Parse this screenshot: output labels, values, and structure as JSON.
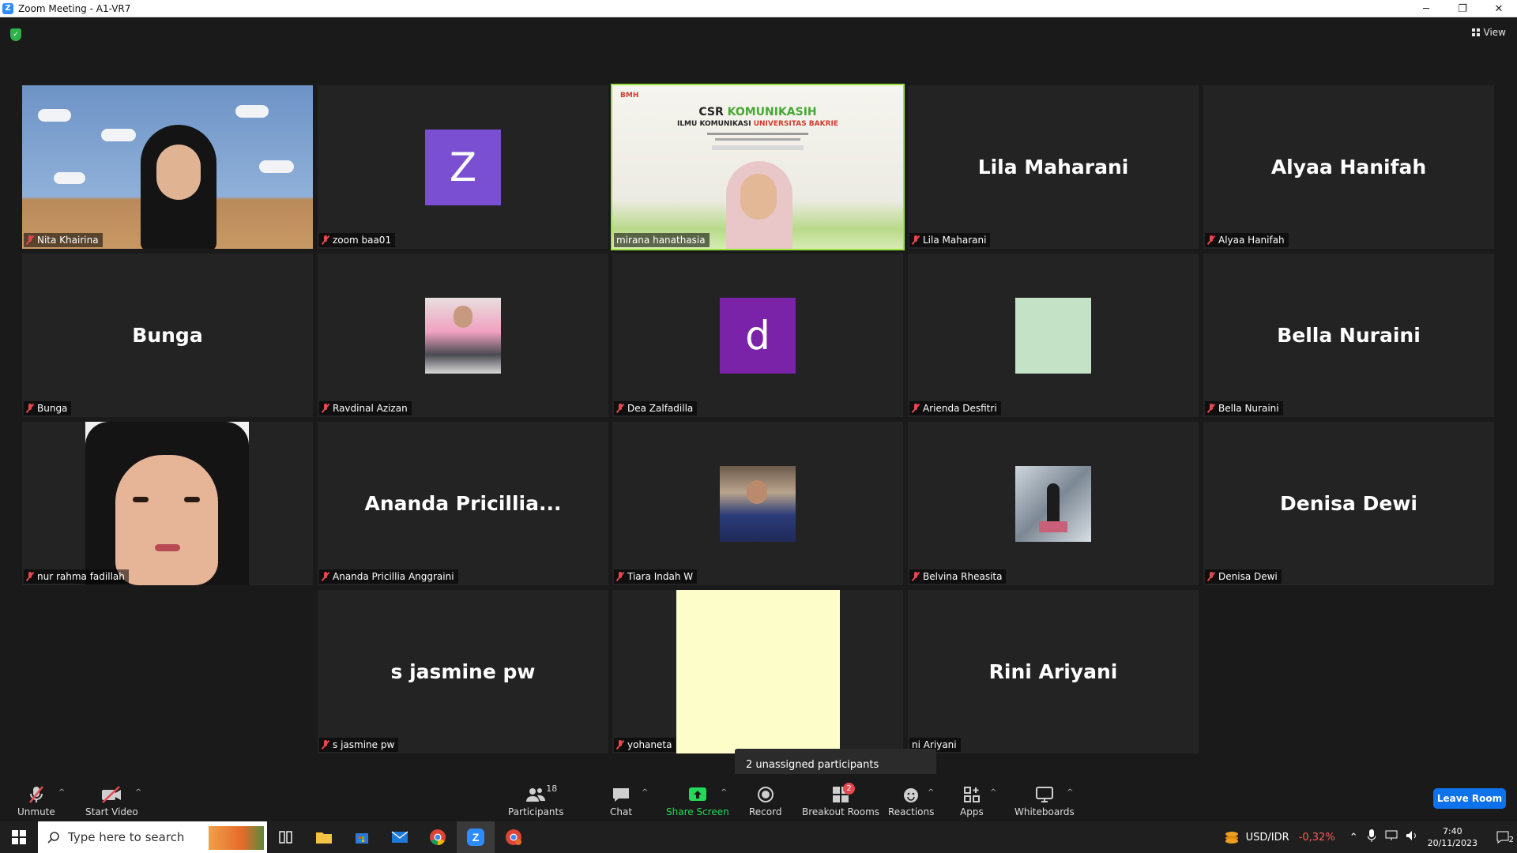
{
  "window": {
    "title": "Zoom Meeting - A1-VR7",
    "app_icon": "zoom-icon",
    "minimize": "─",
    "restore": "❐",
    "close": "✕"
  },
  "header": {
    "view_label": "View",
    "security_icon": "shield-icon"
  },
  "participants": [
    {
      "name": "Nita Khairina",
      "display": "",
      "muted": true
    },
    {
      "name": "zoom baa01",
      "display": "Z",
      "muted": true,
      "avatar_color": "#7b4fd1"
    },
    {
      "name": "mirana hanathasia",
      "display": "",
      "muted": false,
      "active_speaker": true
    },
    {
      "name": "Lila Maharani",
      "display": "Lila Maharani",
      "muted": true
    },
    {
      "name": "Alyaa Hanifah",
      "display": "Alyaa Hanifah",
      "muted": true
    },
    {
      "name": "Bunga",
      "display": "Bunga",
      "muted": true
    },
    {
      "name": "Ravdinal Azizan",
      "display": "",
      "muted": true
    },
    {
      "name": "Dea Zalfadilla",
      "display": "d",
      "muted": true,
      "avatar_color": "#7a22a8"
    },
    {
      "name": "Arienda Desfitri",
      "display": "",
      "muted": true,
      "avatar_color": "#c4e3c6"
    },
    {
      "name": "Bella Nuraini",
      "display": "Bella Nuraini",
      "muted": true
    },
    {
      "name": "nur rahma fadillah",
      "display": "",
      "muted": true
    },
    {
      "name": "Ananda Pricillia Anggraini",
      "display": "Ananda  Pricillia...",
      "muted": true
    },
    {
      "name": "Tiara Indah W",
      "display": "",
      "muted": true
    },
    {
      "name": "Belvina Rheasita",
      "display": "",
      "muted": true
    },
    {
      "name": "Denisa Dewi",
      "display": "Denisa Dewi",
      "muted": true
    },
    {
      "name": "s jasmine pw",
      "display": "s jasmine pw",
      "muted": true
    },
    {
      "name": "yohaneta",
      "display": "",
      "muted": true,
      "avatar_color": "#fdfdc9"
    },
    {
      "name": "Rini Ariyani",
      "display": "Rini Ariyani",
      "muted": true,
      "tag_partial": "ni Ariyani"
    }
  ],
  "slide": {
    "brand_left": "BMH",
    "title_a": "CSR ",
    "title_b": "KOMUNIKASIH",
    "subtitle_a": "ILMU KOMUNIKASI ",
    "subtitle_b": "UNIVERSITAS BAKRIE"
  },
  "tooltip": {
    "text": "2 unassigned participants"
  },
  "toolbar": {
    "unmute": "Unmute",
    "start_video": "Start Video",
    "participants": "Participants",
    "participants_count": "18",
    "chat": "Chat",
    "share_screen": "Share Screen",
    "record": "Record",
    "breakout_rooms": "Breakout Rooms",
    "breakout_badge": "2",
    "reactions": "Reactions",
    "apps": "Apps",
    "whiteboards": "Whiteboards",
    "leave": "Leave Room",
    "colors": {
      "share": "#23d959",
      "leave": "#0e72ed",
      "badge": "#e5484d"
    }
  },
  "taskbar": {
    "search_placeholder": "Type here to search",
    "ticker": "USD/IDR",
    "ticker_change": "-0,32%",
    "time": "7:40",
    "date": "20/11/2023",
    "notification_count": "2"
  }
}
